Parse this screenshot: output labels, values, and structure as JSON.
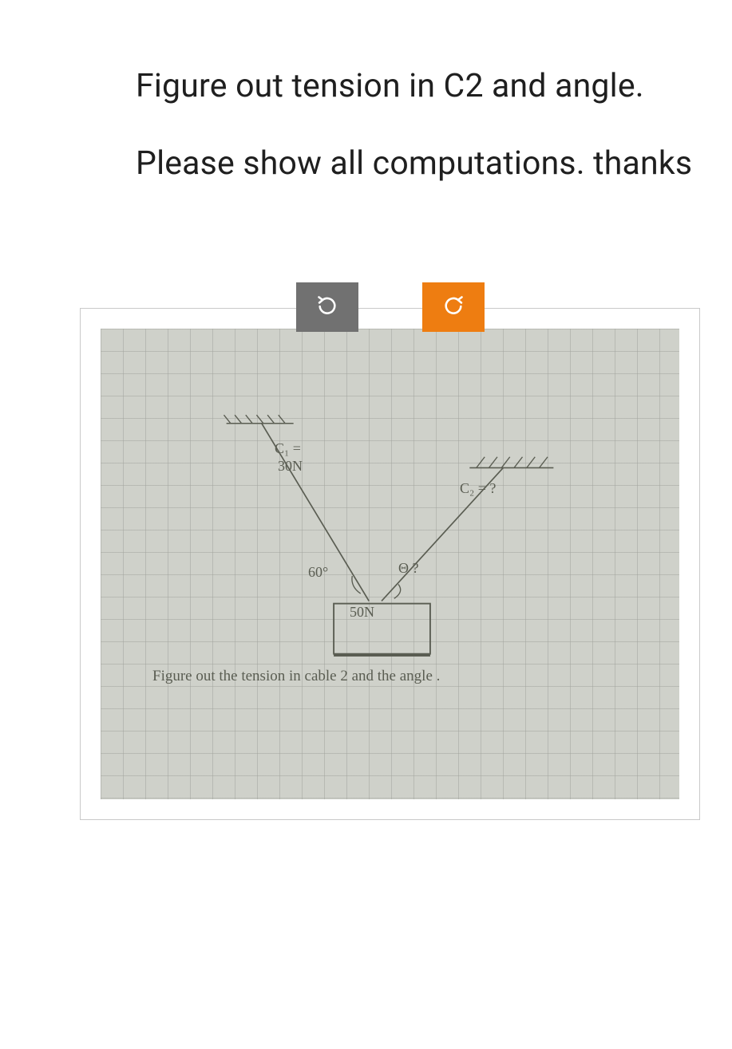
{
  "question": {
    "text": "Figure out tension in C2 and angle. Please show all computations. thanks"
  },
  "diagram": {
    "c1_label": "C₁ =",
    "c1_value": "30N",
    "c2_label": "C₂ = ?",
    "angle1": "60°",
    "angle2": "Θ ?",
    "weight": "50N",
    "caption": "Figure out the tension in cable 2 and the angle ."
  }
}
